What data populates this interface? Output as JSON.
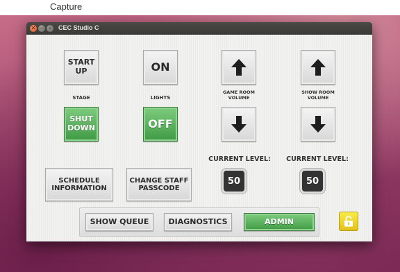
{
  "top_bar": {
    "label": "Capture"
  },
  "window": {
    "title": "CEC Studio C"
  },
  "stage": {
    "start_up": "START\nUP",
    "label": "STAGE",
    "shut_down": "SHUT\nDOWN"
  },
  "lights": {
    "on": "ON",
    "label": "LIGHTS",
    "off": "OFF"
  },
  "game_room": {
    "label": "GAME ROOM\nVOLUME",
    "up_icon": "arrow-up-icon",
    "down_icon": "arrow-down-icon",
    "current_level_label": "CURRENT LEVEL:",
    "current_level": "50"
  },
  "show_room": {
    "label": "SHOW ROOM\nVOLUME",
    "up_icon": "arrow-up-icon",
    "down_icon": "arrow-down-icon",
    "current_level_label": "CURRENT LEVEL:",
    "current_level": "50"
  },
  "actions": {
    "schedule": "SCHEDULE\nINFORMATION",
    "change_passcode": "CHANGE STAFF\nPASSCODE"
  },
  "nav": {
    "show_queue": "SHOW QUEUE",
    "diagnostics": "DIAGNOSTICS",
    "admin": "ADMIN"
  },
  "lock_icon": "unlocked-padlock-icon",
  "colors": {
    "active_green": "#4caf50",
    "lock_yellow": "#f0d62a",
    "level_box": "#333333"
  }
}
